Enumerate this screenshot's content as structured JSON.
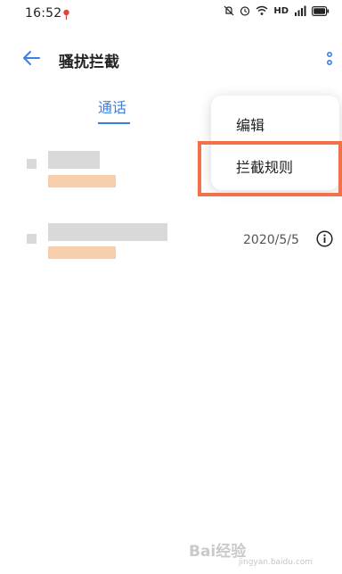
{
  "status_bar": {
    "time": "16:52",
    "network": "HD",
    "icons": [
      "location-icon",
      "mute-icon",
      "alarm-icon",
      "wifi-icon",
      "signal-icon",
      "battery-icon"
    ]
  },
  "header": {
    "title": "骚扰拦截",
    "back_icon": "arrow-left-icon",
    "more_icon": "more-vertical-icon"
  },
  "tabs": [
    {
      "label": "通话",
      "active": true
    }
  ],
  "list": [
    {
      "name": "",
      "sub": "",
      "date": ""
    },
    {
      "name": "",
      "sub": "",
      "date": "2020/5/5"
    }
  ],
  "menu": {
    "items": [
      {
        "label": "编辑"
      },
      {
        "label": "拦截规则",
        "highlighted": true
      }
    ]
  },
  "watermark": {
    "text": "Bai经验",
    "url": "jingyan.baidu.com"
  },
  "colors": {
    "accent": "#3d7fe0",
    "highlight": "#f0724a",
    "blur_gray": "#d9d9d9",
    "blur_orange": "#f6cfae"
  }
}
